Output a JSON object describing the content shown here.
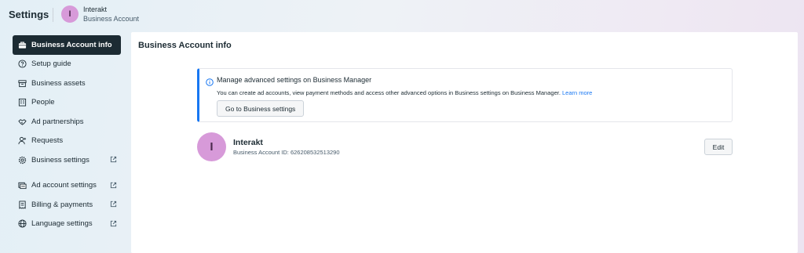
{
  "header": {
    "title": "Settings",
    "account_initial": "I",
    "account_name": "Interakt",
    "account_type": "Business Account"
  },
  "sidebar": {
    "items": [
      {
        "label": "Business Account info",
        "icon": "briefcase-icon",
        "active": true,
        "external": false
      },
      {
        "label": "Setup guide",
        "icon": "question-circle-icon",
        "active": false,
        "external": false
      },
      {
        "label": "Business assets",
        "icon": "archive-box-icon",
        "active": false,
        "external": false
      },
      {
        "label": "People",
        "icon": "building-icon",
        "active": false,
        "external": false
      },
      {
        "label": "Ad partnerships",
        "icon": "handshake-icon",
        "active": false,
        "external": false
      },
      {
        "label": "Requests",
        "icon": "person-add-icon",
        "active": false,
        "external": false
      },
      {
        "label": "Business settings",
        "icon": "gear-icon",
        "active": false,
        "external": true
      },
      {
        "label": "Ad account settings",
        "icon": "ad-account-icon",
        "active": false,
        "external": true
      },
      {
        "label": "Billing & payments",
        "icon": "receipt-icon",
        "active": false,
        "external": true
      },
      {
        "label": "Language settings",
        "icon": "globe-icon",
        "active": false,
        "external": true
      }
    ]
  },
  "main": {
    "title": "Business Account info",
    "info_banner": {
      "icon": "info-icon",
      "title": "Manage advanced settings on Business Manager",
      "description": "You can create ad accounts, view payment methods and access other advanced options in Business settings on Business Manager.",
      "link_label": "Learn more",
      "button_label": "Go to Business settings"
    },
    "account": {
      "initial": "I",
      "name": "Interakt",
      "id_text": "Business Account ID: 626208532513290",
      "edit_label": "Edit"
    }
  },
  "colors": {
    "accent": "#1877f2",
    "avatar": "#d79ad9",
    "active_nav": "#1c2b33"
  }
}
